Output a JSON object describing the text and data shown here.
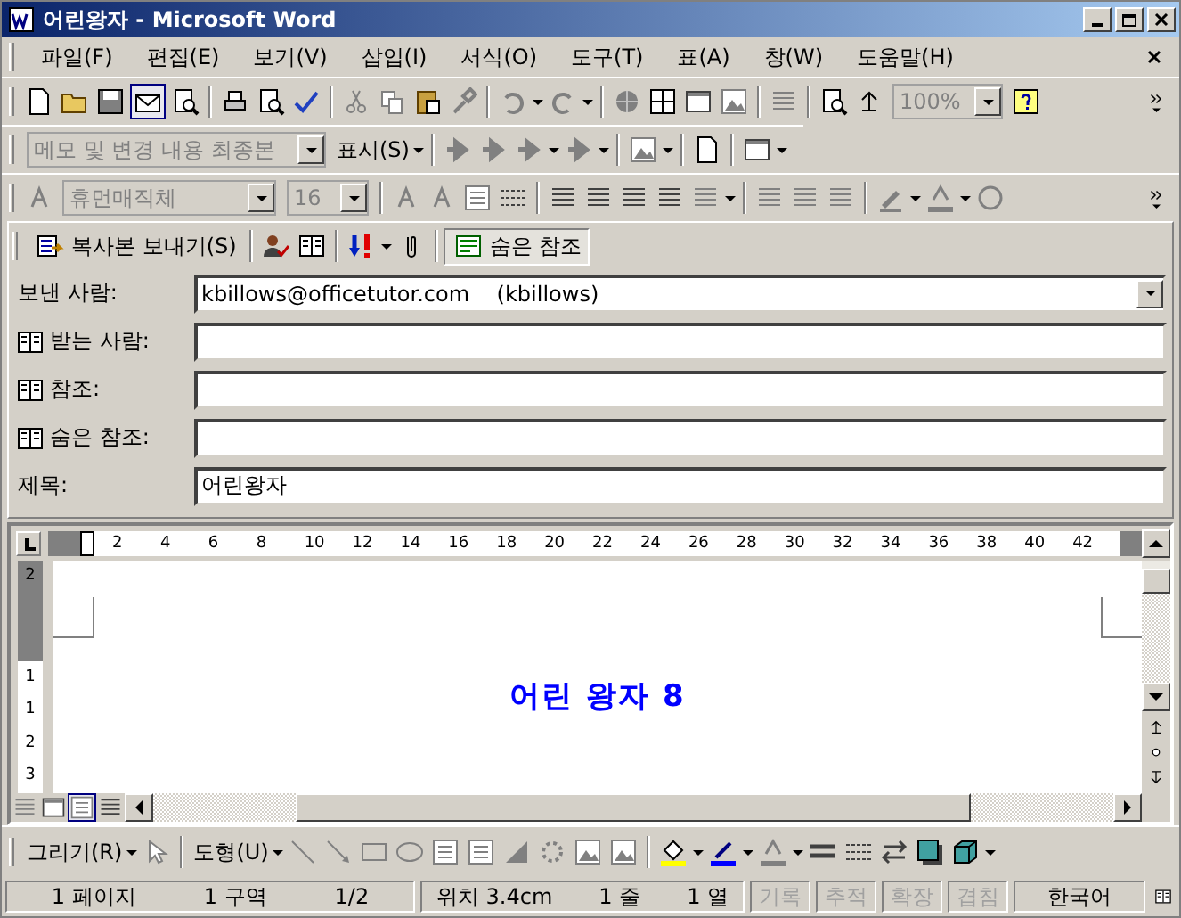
{
  "window": {
    "title": "어린왕자 - Microsoft Word"
  },
  "menu": [
    {
      "label": "파일(F)"
    },
    {
      "label": "편집(E)"
    },
    {
      "label": "보기(V)"
    },
    {
      "label": "삽입(I)"
    },
    {
      "label": "서식(O)"
    },
    {
      "label": "도구(T)"
    },
    {
      "label": "표(A)"
    },
    {
      "label": "창(W)"
    },
    {
      "label": "도움말(H)"
    }
  ],
  "toolbar_standard": {
    "zoom": "100%"
  },
  "toolbar_review": {
    "display_mode": "메모 및 변경 내용 최종본",
    "show_menu": "표시(S)"
  },
  "toolbar_format": {
    "font": "휴먼매직체",
    "size": "16"
  },
  "mail_toolbar": {
    "send_button": "복사본 보내기(S)",
    "bcc_button": "숨은 참조"
  },
  "fields": [
    {
      "kind": "dropdown",
      "label": "보낸 사람:",
      "value": "kbillows@officetutor.com    (kbillows)"
    },
    {
      "kind": "address",
      "label": "받는 사람:"
    },
    {
      "kind": "address",
      "label": "참조:"
    },
    {
      "kind": "address",
      "label": "숨은 참조:"
    },
    {
      "kind": "text",
      "label": "제목:",
      "value": "어린왕자"
    }
  ],
  "ruler": {
    "ticks": [
      "2",
      "4",
      "6",
      "8",
      "10",
      "12",
      "14",
      "16",
      "18",
      "20",
      "22",
      "24",
      "26",
      "28",
      "30",
      "32",
      "34",
      "36",
      "38",
      "40",
      "42"
    ],
    "vertical_ticks": [
      "2",
      "1",
      "1",
      "2",
      "3"
    ]
  },
  "document": {
    "heading": "어린 왕자 8"
  },
  "drawing_toolbar": {
    "draw_menu": "그리기(R)",
    "shapes_menu": "도형(U)"
  },
  "status_bar": [
    {
      "items": [
        "1 페이지",
        "1 구역",
        "1/2"
      ],
      "disabled": false
    },
    {
      "items": [
        "위치 3.4cm",
        "1 줄",
        "1 열"
      ],
      "disabled": false
    },
    {
      "items": [
        "기록"
      ],
      "disabled": true
    },
    {
      "items": [
        "추적"
      ],
      "disabled": true
    },
    {
      "items": [
        "확장"
      ],
      "disabled": true
    },
    {
      "items": [
        "겹침"
      ],
      "disabled": true
    },
    {
      "items": [
        "한국어"
      ],
      "disabled": false
    }
  ]
}
